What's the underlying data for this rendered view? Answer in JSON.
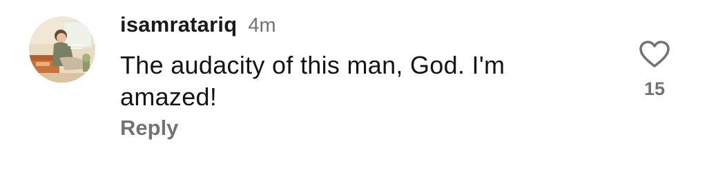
{
  "comment": {
    "username": "isamratariq",
    "timestamp": "4m",
    "text_line1": "The audacity of this man, God. I'm",
    "text_line2": "amazed!",
    "reply_label": "Reply",
    "like_count": "15",
    "avatar_image_text": "",
    "icons": {
      "like": "heart-outline-icon",
      "avatar": "profile-picture"
    }
  }
}
